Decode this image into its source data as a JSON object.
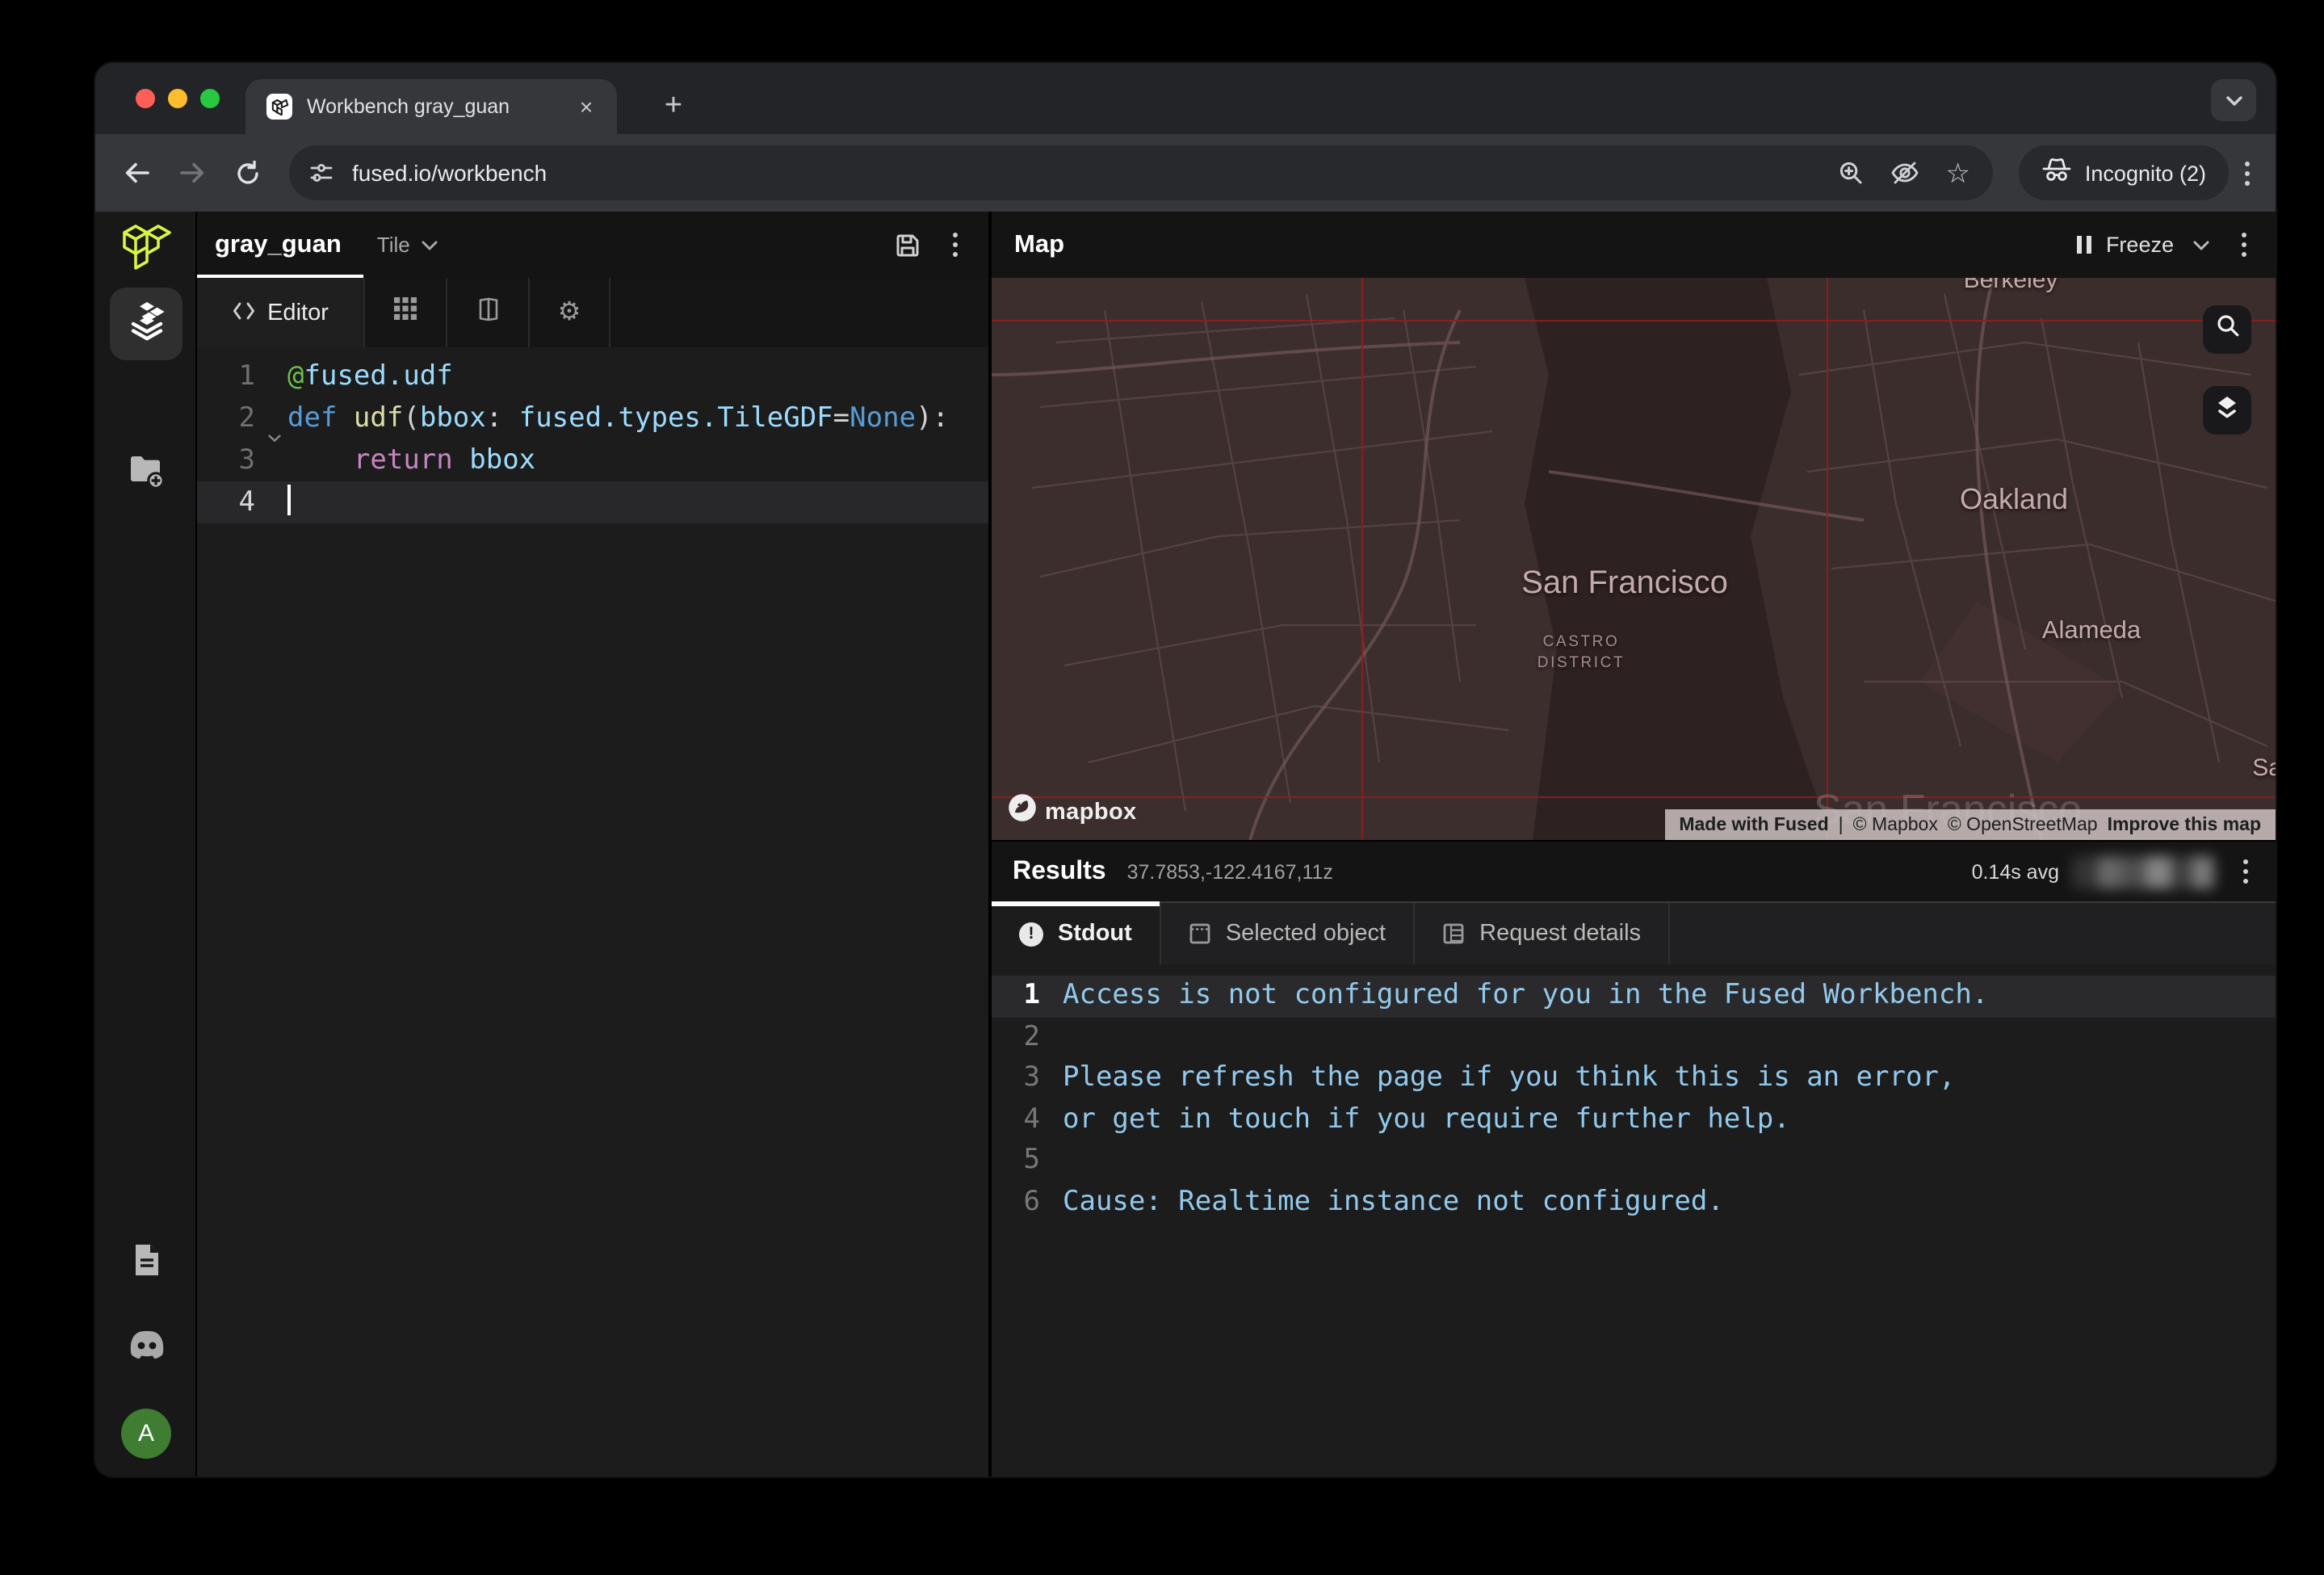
{
  "browser": {
    "tab_title": "Workbench gray_guan",
    "close_glyph": "×",
    "new_tab_glyph": "+",
    "url": "fused.io/workbench",
    "incognito_label": "Incognito (2)"
  },
  "sidebar": {
    "avatar_letter": "A"
  },
  "editor": {
    "udf_name": "gray_guan",
    "mode_label": "Tile",
    "tab_label": "Editor",
    "code": [
      {
        "n": 1,
        "fold": false,
        "active": false,
        "tokens": [
          [
            "@",
            "tok-dec"
          ],
          [
            "fused.udf",
            "tok-attr"
          ]
        ]
      },
      {
        "n": 2,
        "fold": true,
        "active": false,
        "tokens": [
          [
            "def ",
            "tok-kw"
          ],
          [
            "udf",
            "tok-fn"
          ],
          [
            "(",
            "tok-plain"
          ],
          [
            "bbox",
            "tok-var"
          ],
          [
            ": ",
            "tok-plain"
          ],
          [
            "fused.types.TileGDF",
            "tok-attr"
          ],
          [
            "=",
            "tok-plain"
          ],
          [
            "None",
            "tok-kw2"
          ],
          [
            "):",
            "tok-plain"
          ]
        ]
      },
      {
        "n": 3,
        "fold": false,
        "active": false,
        "tokens": [
          [
            "    ",
            "tok-plain"
          ],
          [
            "return",
            "tok-ctrl"
          ],
          [
            " ",
            "tok-plain"
          ],
          [
            "bbox",
            "tok-attr"
          ]
        ]
      },
      {
        "n": 4,
        "fold": false,
        "active": true,
        "tokens": []
      }
    ]
  },
  "map": {
    "title": "Map",
    "freeze_label": "Freeze",
    "labels": {
      "berkeley": "Berkeley",
      "oakland": "Oakland",
      "san_francisco": "San Francisco",
      "castro_line1": "CASTRO",
      "castro_line2": "DISTRICT",
      "alameda": "Alameda",
      "sa_partial": "Sa",
      "watermark": "San Francisco"
    },
    "logo_text": "mapbox",
    "attribution": {
      "made_with": "Made with Fused",
      "sep": "|",
      "mapbox": "© Mapbox",
      "osm": "© OpenStreetMap",
      "improve": "Improve this map"
    }
  },
  "results": {
    "title": "Results",
    "coords": "37.7853,-122.4167,11z",
    "avg_label": "0.14s avg",
    "tabs": [
      {
        "label": "Stdout",
        "icon": "stdout-info-icon",
        "active": true
      },
      {
        "label": "Selected object",
        "icon": "selected-object-icon",
        "active": false
      },
      {
        "label": "Request details",
        "icon": "request-details-icon",
        "active": false
      }
    ],
    "stdout": [
      {
        "n": 1,
        "active": true,
        "text": "Access is not configured for you in the Fused Workbench."
      },
      {
        "n": 2,
        "active": false,
        "text": ""
      },
      {
        "n": 3,
        "active": false,
        "text": "Please refresh the page if you think this is an error,"
      },
      {
        "n": 4,
        "active": false,
        "text": "or get in touch if you require further help."
      },
      {
        "n": 5,
        "active": false,
        "text": ""
      },
      {
        "n": 6,
        "active": false,
        "text": "Cause: Realtime instance not configured."
      }
    ]
  },
  "colors": {
    "accent_lime": "#d7f643",
    "map_grid_red": "#8c1d1d",
    "stdout_blue": "#93c9ec",
    "avatar_green": "#3e7d32"
  }
}
